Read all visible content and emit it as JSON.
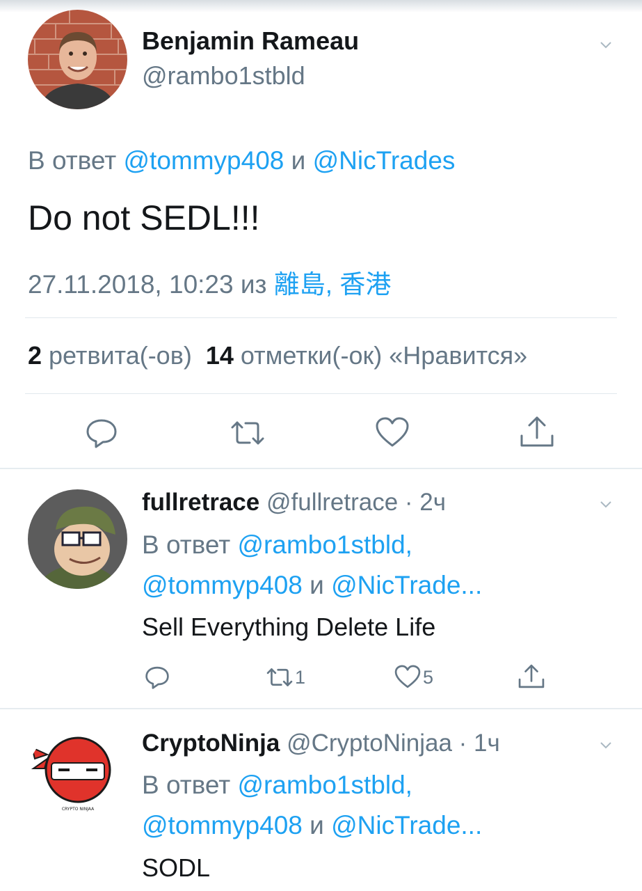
{
  "main_tweet": {
    "name": "Benjamin Rameau",
    "handle": "@rambo1stbld",
    "reply_prefix": "В ответ ",
    "reply_user1": "@tommyp408",
    "reply_and": " и ",
    "reply_user2": "@NicTrades",
    "text": "Do not SEDL!!!",
    "timestamp": "27.11.2018, 10:23",
    "from_word": " из ",
    "location": "離島, 香港",
    "retweets_count": "2",
    "retweets_label": " ретвита(-ов)",
    "likes_count": "14",
    "likes_label": " отметки(-ок) «Нравится»"
  },
  "replies": [
    {
      "name": "fullretrace",
      "handle": " @fullretrace",
      "time": " · 2ч",
      "reply_prefix": "В ответ ",
      "reply_line1_user": "@rambo1stbld,",
      "reply_line2_user1": "@tommyp408",
      "reply_and": " и ",
      "reply_line2_user2": "@NicTrade...",
      "text": "Sell Everything Delete Life",
      "retweet_count": "1",
      "like_count": "5"
    },
    {
      "name": "CryptoNinja",
      "handle": " @CryptoNinjaa",
      "time": " · 1ч",
      "reply_prefix": "В ответ ",
      "reply_line1_user": "@rambo1stbld,",
      "reply_line2_user1": "@tommyp408",
      "reply_and": " и ",
      "reply_line2_user2": "@NicTrade...",
      "text": "SODL",
      "avatar_caption": "CRYPTO NINJAA"
    }
  ],
  "icons": [
    "reply-icon",
    "retweet-icon",
    "like-icon",
    "share-icon",
    "chevron-down-icon"
  ],
  "colors": {
    "link": "#1da1f2",
    "secondary_text": "#657786",
    "divider": "#e1e8ed",
    "ninja_red": "#e0332b"
  }
}
